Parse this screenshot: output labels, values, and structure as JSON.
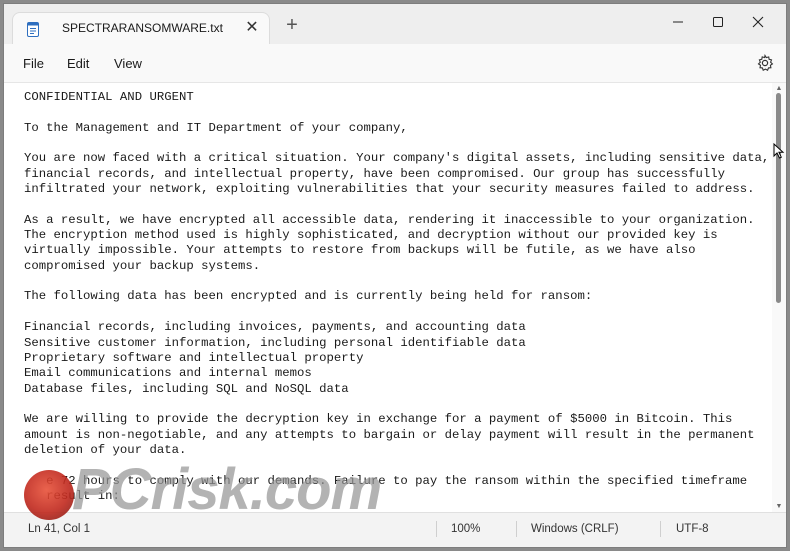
{
  "tab": {
    "title": "SPECTRARANSOMWARE.txt",
    "close_glyph": "✕",
    "new_tab_glyph": "+"
  },
  "menu": {
    "file": "File",
    "edit": "Edit",
    "view": "View"
  },
  "editor": {
    "content": "CONFIDENTIAL AND URGENT\n\nTo the Management and IT Department of your company,\n\nYou are now faced with a critical situation. Your company's digital assets, including sensitive data,\nfinancial records, and intellectual property, have been compromised. Our group has successfully\ninfiltrated your network, exploiting vulnerabilities that your security measures failed to address.\n\nAs a result, we have encrypted all accessible data, rendering it inaccessible to your organization.\nThe encryption method used is highly sophisticated, and decryption without our provided key is\nvirtually impossible. Your attempts to restore from backups will be futile, as we have also\ncompromised your backup systems.\n\nThe following data has been encrypted and is currently being held for ransom:\n\nFinancial records, including invoices, payments, and accounting data\nSensitive customer information, including personal identifiable data\nProprietary software and intellectual property\nEmail communications and internal memos\nDatabase files, including SQL and NoSQL data\n\nWe are willing to provide the decryption key in exchange for a payment of $5000 in Bitcoin. This\namount is non-negotiable, and any attempts to bargain or delay payment will result in the permanent\ndeletion of your data.\n\n   e 72 hours to comply with our demands. Failure to pay the ransom within the specified timeframe\n   result in:"
  },
  "status": {
    "position": "Ln 41, Col 1",
    "zoom": "100%",
    "line_ending": "Windows (CRLF)",
    "encoding": "UTF-8"
  },
  "watermark": {
    "text": "PCrisk.com"
  },
  "icons": {
    "app": "notepad-icon",
    "settings": "gear-icon",
    "minimize": "minimize-icon",
    "maximize": "maximize-icon",
    "close": "close-icon"
  }
}
